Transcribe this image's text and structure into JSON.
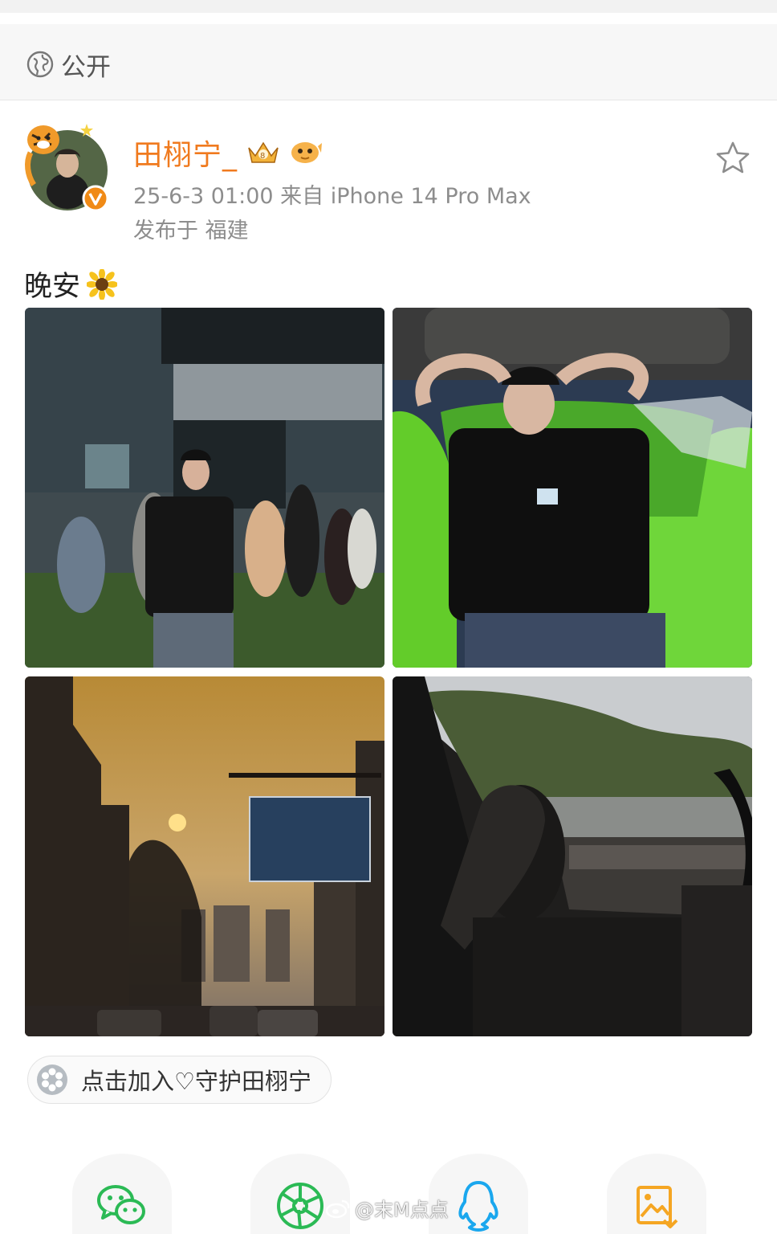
{
  "privacy": {
    "label": "公开",
    "icon": "globe-icon"
  },
  "post": {
    "author": "田栩宁_",
    "time_source": "25-6-3 01:00  来自 iPhone 14 Pro Max",
    "location": "发布于 福建",
    "text": "晚安",
    "emoji": "sunflower-icon",
    "photos": [
      {
        "alt": "concert-crowd-photo"
      },
      {
        "alt": "green-inflatable-lounger-photo"
      },
      {
        "alt": "sunset-street-photo"
      },
      {
        "alt": "car-window-lake-photo"
      }
    ]
  },
  "guard_button": {
    "label": "点击加入♡守护田栩宁"
  },
  "share": {
    "items": [
      {
        "icon": "wechat-icon"
      },
      {
        "icon": "moments-icon"
      },
      {
        "icon": "qq-icon"
      },
      {
        "icon": "save-image-icon"
      }
    ]
  },
  "watermark": "@末M点点",
  "colors": {
    "username": "#f07a1e",
    "meta": "#8d8d8d",
    "verified": "#f08a16",
    "wechat": "#2bba55",
    "qq": "#1aa7ee",
    "save": "#f5a623"
  }
}
